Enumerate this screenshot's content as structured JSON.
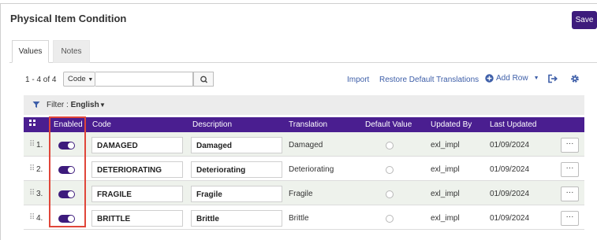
{
  "page": {
    "title": "Physical Item Condition",
    "save_label": "Save"
  },
  "tabs": [
    {
      "label": "Values",
      "active": true
    },
    {
      "label": "Notes",
      "active": false
    }
  ],
  "toolbar": {
    "count_text": "1 - 4 of 4",
    "code_select_label": "Code",
    "search_value": "",
    "import_label": "Import",
    "restore_label": "Restore Default Translations",
    "add_row_label": "Add Row"
  },
  "filter": {
    "label": "Filter :",
    "value": "English"
  },
  "table": {
    "columns": [
      "Enabled",
      "Code",
      "Description",
      "Translation",
      "Default Value",
      "Updated By",
      "Last Updated"
    ],
    "rows": [
      {
        "num": "1.",
        "enabled": true,
        "code": "DAMAGED",
        "description": "Damaged",
        "translation": "Damaged",
        "default_value": false,
        "updated_by": "exl_impl",
        "last_updated": "01/09/2024"
      },
      {
        "num": "2.",
        "enabled": true,
        "code": "DETERIORATING",
        "description": "Deteriorating",
        "translation": "Deteriorating",
        "default_value": false,
        "updated_by": "exl_impl",
        "last_updated": "01/09/2024"
      },
      {
        "num": "3.",
        "enabled": true,
        "code": "FRAGILE",
        "description": "Fragile",
        "translation": "Fragile",
        "default_value": false,
        "updated_by": "exl_impl",
        "last_updated": "01/09/2024"
      },
      {
        "num": "4.",
        "enabled": true,
        "code": "BRITTLE",
        "description": "Brittle",
        "translation": "Brittle",
        "default_value": false,
        "updated_by": "exl_impl",
        "last_updated": "01/09/2024"
      }
    ],
    "more_label": "···"
  },
  "icons": {
    "drag": "drag-handle-icon",
    "search": "search-icon",
    "add": "plus-circle-icon",
    "export": "export-icon",
    "settings": "gear-icon",
    "filter": "funnel-icon",
    "columns": "grid-icon"
  },
  "colors": {
    "accent": "#3d1b7c",
    "header": "#4a1e90",
    "link": "#3d5ea8",
    "highlight": "#e0463a"
  }
}
